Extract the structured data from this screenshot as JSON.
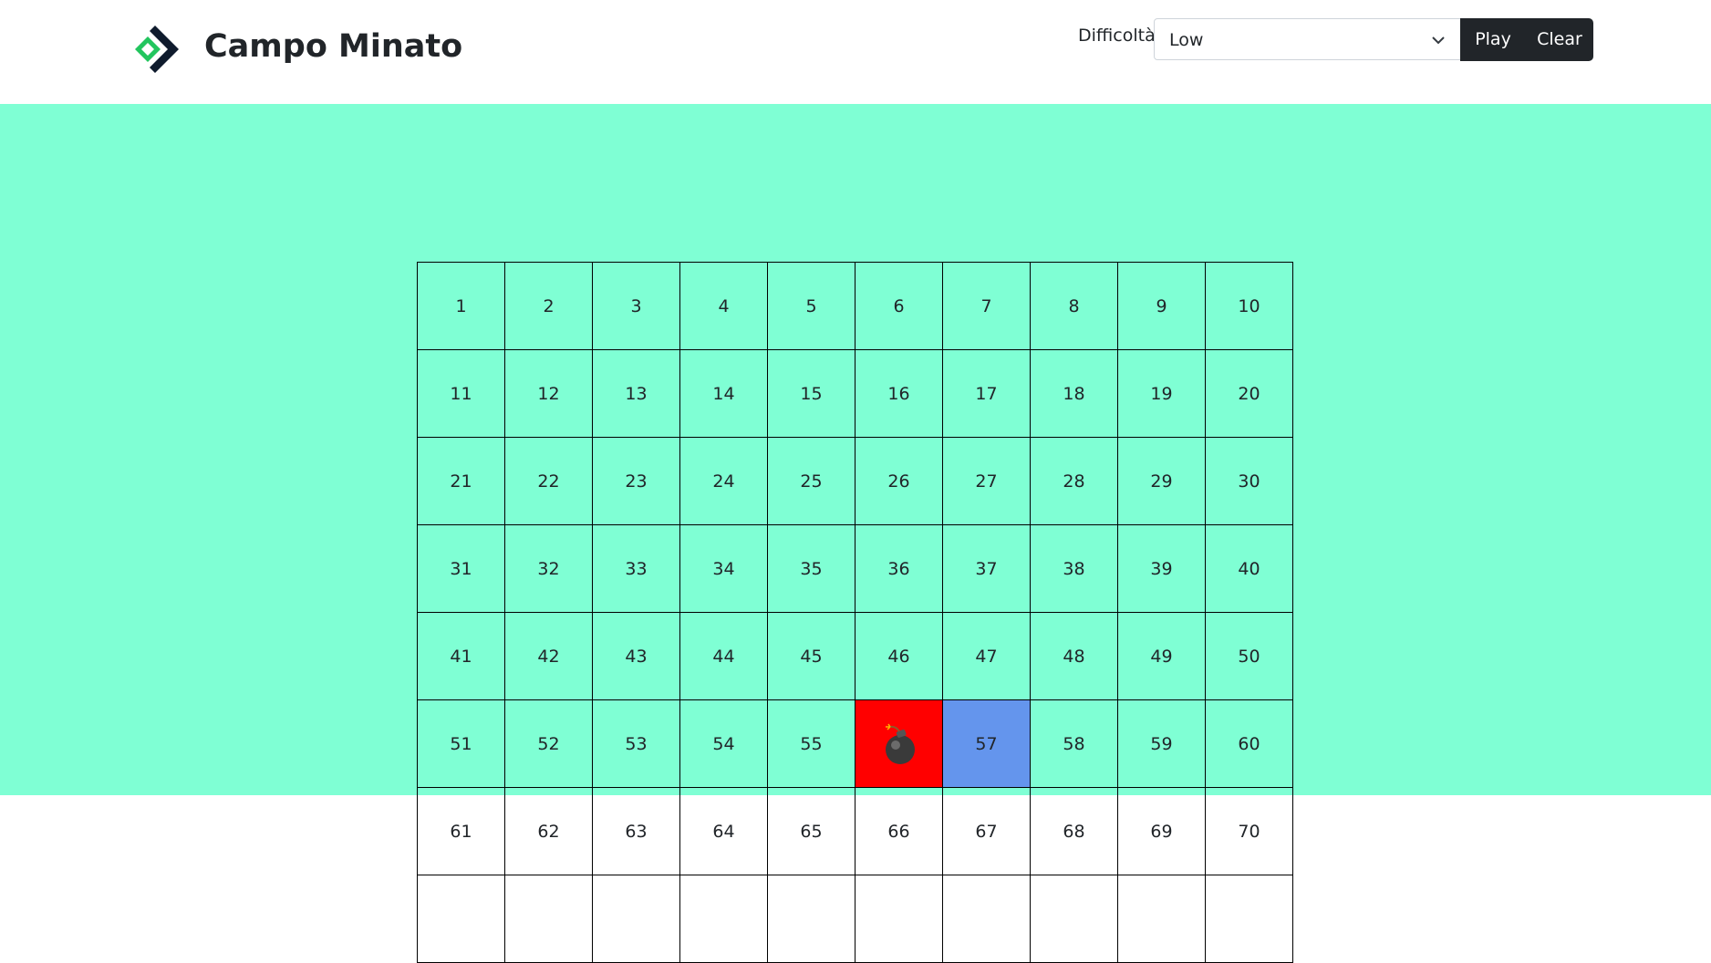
{
  "header": {
    "title": "Campo Minato",
    "difficulty_label": "Difficoltà",
    "difficulty_selected": "Low",
    "play_label": "Play",
    "clear_label": "Clear",
    "brand_colors": {
      "green": "#22c55e",
      "navy": "#0f1b2d"
    }
  },
  "board": {
    "background": "#7fffd4",
    "bomb_color": "#ff0000",
    "revealed_color": "#6495ed",
    "cells": [
      {
        "label": "1"
      },
      {
        "label": "2"
      },
      {
        "label": "3"
      },
      {
        "label": "4"
      },
      {
        "label": "5"
      },
      {
        "label": "6"
      },
      {
        "label": "7"
      },
      {
        "label": "8"
      },
      {
        "label": "9"
      },
      {
        "label": "10"
      },
      {
        "label": "11"
      },
      {
        "label": "12"
      },
      {
        "label": "13"
      },
      {
        "label": "14"
      },
      {
        "label": "15"
      },
      {
        "label": "16"
      },
      {
        "label": "17"
      },
      {
        "label": "18"
      },
      {
        "label": "19"
      },
      {
        "label": "20"
      },
      {
        "label": "21"
      },
      {
        "label": "22"
      },
      {
        "label": "23"
      },
      {
        "label": "24"
      },
      {
        "label": "25"
      },
      {
        "label": "26"
      },
      {
        "label": "27"
      },
      {
        "label": "28"
      },
      {
        "label": "29"
      },
      {
        "label": "30"
      },
      {
        "label": "31"
      },
      {
        "label": "32"
      },
      {
        "label": "33"
      },
      {
        "label": "34"
      },
      {
        "label": "35"
      },
      {
        "label": "36"
      },
      {
        "label": "37"
      },
      {
        "label": "38"
      },
      {
        "label": "39"
      },
      {
        "label": "40"
      },
      {
        "label": "41"
      },
      {
        "label": "42"
      },
      {
        "label": "43"
      },
      {
        "label": "44"
      },
      {
        "label": "45"
      },
      {
        "label": "46"
      },
      {
        "label": "47"
      },
      {
        "label": "48"
      },
      {
        "label": "49"
      },
      {
        "label": "50"
      },
      {
        "label": "51"
      },
      {
        "label": "52"
      },
      {
        "label": "53"
      },
      {
        "label": "54"
      },
      {
        "label": "55"
      },
      {
        "label": "",
        "state": "bomb",
        "icon": "bomb-icon"
      },
      {
        "label": "57",
        "state": "revealed"
      },
      {
        "label": "58"
      },
      {
        "label": "59"
      },
      {
        "label": "60"
      },
      {
        "label": "61"
      },
      {
        "label": "62"
      },
      {
        "label": "63"
      },
      {
        "label": "64"
      },
      {
        "label": "65"
      },
      {
        "label": "66"
      },
      {
        "label": "67"
      },
      {
        "label": "68"
      },
      {
        "label": "69"
      },
      {
        "label": "70"
      },
      {
        "label": ""
      },
      {
        "label": ""
      },
      {
        "label": ""
      },
      {
        "label": ""
      },
      {
        "label": ""
      },
      {
        "label": ""
      },
      {
        "label": ""
      },
      {
        "label": ""
      },
      {
        "label": ""
      },
      {
        "label": ""
      }
    ]
  }
}
